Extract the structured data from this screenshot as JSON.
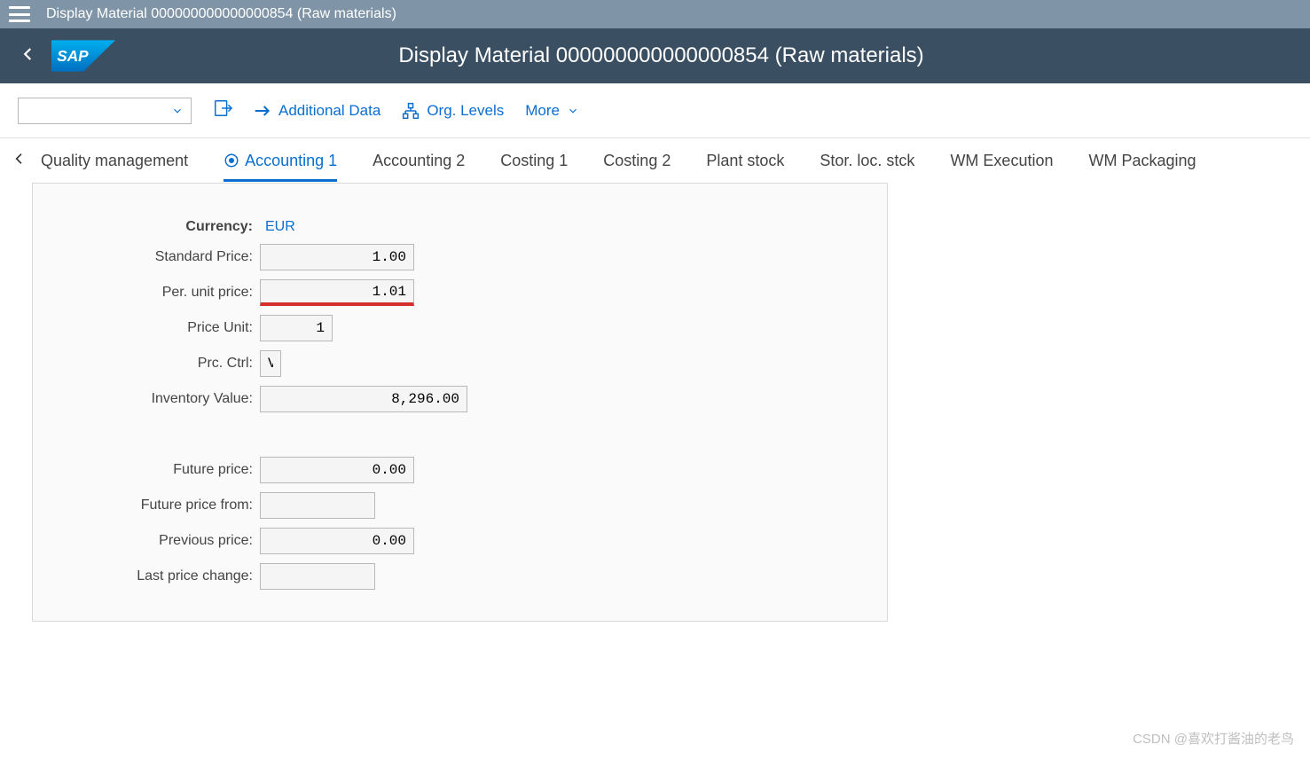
{
  "titlebar": {
    "text": "Display Material 000000000000000854 (Raw materials)"
  },
  "header": {
    "title": "Display Material 000000000000000854 (Raw materials)"
  },
  "toolbar": {
    "additional_data": "Additional Data",
    "org_levels": "Org. Levels",
    "more": "More"
  },
  "tabs": {
    "prev_label": "Quality management",
    "items": [
      "Accounting 1",
      "Accounting 2",
      "Costing 1",
      "Costing 2",
      "Plant stock",
      "Stor. loc. stck",
      "WM Execution",
      "WM Packaging"
    ]
  },
  "form": {
    "currency_label": "Currency:",
    "currency_value": "EUR",
    "standard_price_label": "Standard Price:",
    "standard_price_value": "1.00",
    "per_unit_price_label": "Per. unit price:",
    "per_unit_price_value": "1.01",
    "price_unit_label": "Price Unit:",
    "price_unit_value": "1",
    "prc_ctrl_label": "Prc. Ctrl:",
    "prc_ctrl_value": "V",
    "inventory_value_label": "Inventory Value:",
    "inventory_value_value": "8,296.00",
    "future_price_label": "Future price:",
    "future_price_value": "0.00",
    "future_price_from_label": "Future price from:",
    "future_price_from_value": "",
    "previous_price_label": "Previous price:",
    "previous_price_value": "0.00",
    "last_price_change_label": "Last price change:",
    "last_price_change_value": ""
  },
  "watermark": "CSDN @喜欢打酱油的老鸟"
}
